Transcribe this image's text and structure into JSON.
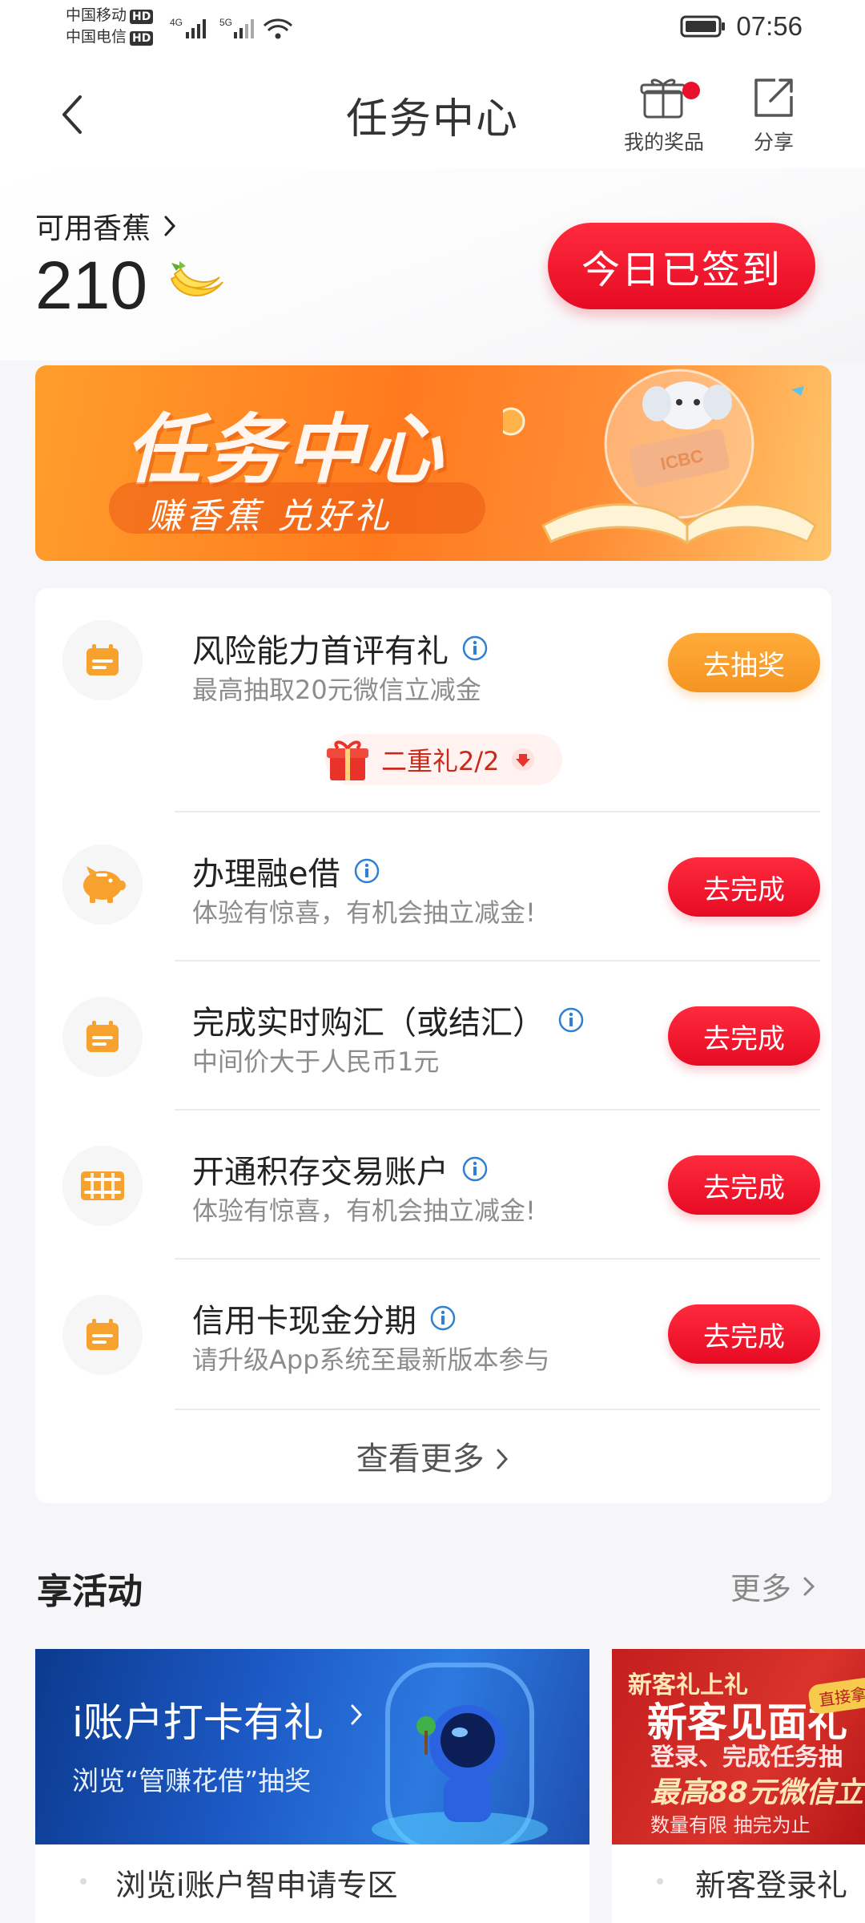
{
  "status_bar": {
    "carrier_1": "中国移动",
    "carrier_2": "中国电信",
    "hd_badge": "HD",
    "net_1": "4G",
    "net_2": "5G",
    "time": "07:56"
  },
  "header": {
    "title": "任务中心",
    "prize_label": "我的奖品",
    "share_label": "分享"
  },
  "balance": {
    "label": "可用香蕉",
    "value": "210",
    "checkin_label": "今日已签到"
  },
  "banner": {
    "title": "任务中心",
    "subtitle": "赚香蕉 兑好礼",
    "logo_text": "ICBC"
  },
  "tasks": [
    {
      "title": "风险能力首评有礼",
      "desc": "最高抽取20元微信立减金",
      "button": "去抽奖",
      "icon": "calendar-icon",
      "button_style": "orange"
    },
    {
      "title": "办理融e借",
      "desc": "体验有惊喜，有机会抽立减金!",
      "button": "去完成",
      "icon": "piggy-bank-icon",
      "button_style": "red"
    },
    {
      "title": "完成实时购汇（或结汇）",
      "desc": "中间价大于人民币1元",
      "button": "去完成",
      "icon": "calendar-icon",
      "button_style": "red"
    },
    {
      "title": "开通积存交易账户",
      "desc": "体验有惊喜，有机会抽立减金!",
      "button": "去完成",
      "icon": "gold-bars-icon",
      "button_style": "red"
    },
    {
      "title": "信用卡现金分期",
      "desc": "请升级App系统至最新版本参与",
      "button": "去完成",
      "icon": "calendar-icon",
      "button_style": "red"
    }
  ],
  "double_gift": {
    "label": "二重礼2/2"
  },
  "more_tasks": {
    "label": "查看更多"
  },
  "activities": {
    "title": "享活动",
    "more_label": "更多",
    "cards": [
      {
        "image_title": "i账户打卡有礼",
        "image_subtitle": "浏览“管赚花借”抽奖",
        "caption": "浏览i账户智申请专区"
      },
      {
        "image_line_1": "新客礼上礼",
        "image_line_2": "新客见面礼",
        "image_line_3": "登录、完成任务抽",
        "image_line_4": "最高88元微信立",
        "image_line_5": "数量有限 抽完为止",
        "badge": "直接拿",
        "caption": "新客登录礼"
      }
    ]
  },
  "colors": {
    "primary_red": "#e60b23",
    "orange": "#f59421",
    "icon_orange": "#f7a12e",
    "info_blue": "#2f7fd2"
  }
}
